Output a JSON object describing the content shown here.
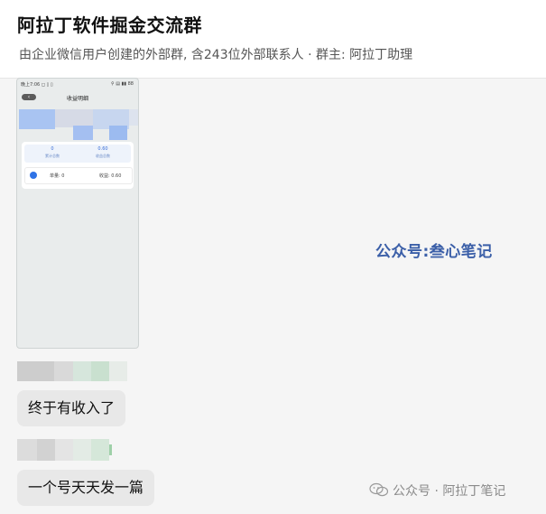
{
  "header": {
    "title": "阿拉丁软件掘金交流群",
    "subtitle": "由企业微信用户创建的外部群, 含243位外部联系人 · 群主: 阿拉丁助理"
  },
  "screenshot": {
    "status_left": "晚上7:06 ◻ ▯ ▯ ",
    "status_right": "⚲ ▤ ▮▮ 88",
    "back_label": "‹",
    "page_title": "收益明细",
    "stat_left_value": "0",
    "stat_left_label": "累计总数",
    "stat_right_value": "0.60",
    "stat_right_label": "收益总数",
    "row_left": "单量:  0",
    "row_right": "收益:  0.60"
  },
  "overlay_text": "公众号:叁心笔记",
  "messages": [
    {
      "text": "终于有收入了"
    },
    {
      "text": "一个号天天发一篇"
    }
  ],
  "footer": {
    "icon": "wechat-icon",
    "text": "公众号 · 阿拉丁笔记"
  },
  "colors": {
    "accent": "#3b5fa8",
    "stat_blue": "#3a6fd8",
    "bubble": "#e8e8e8"
  }
}
